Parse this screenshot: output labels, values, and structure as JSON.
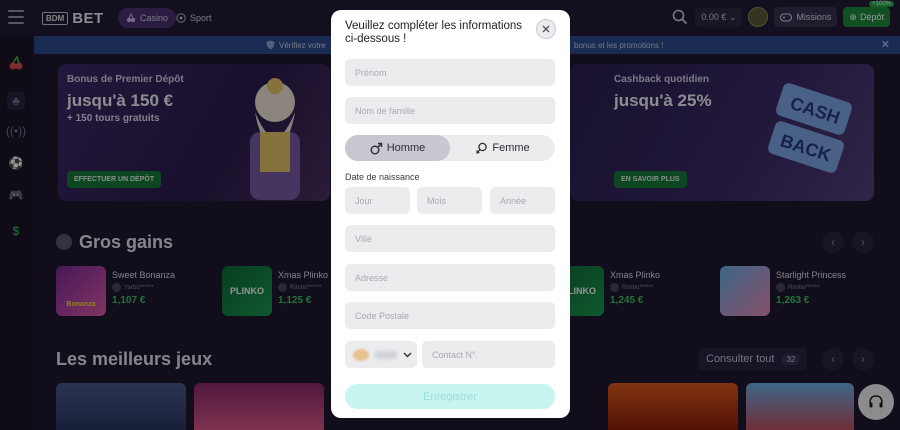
{
  "header": {
    "logo_box": "BDM",
    "logo_text": "BET",
    "nav": {
      "casino": "Casino",
      "sport": "Sport"
    },
    "balance": "0.00 € ⌄",
    "missions": "Missions",
    "depot": "Dépôt",
    "depot_badge": "+100%"
  },
  "notice": {
    "left": "Vérifiez votre",
    "right": "bonus et les promotions !"
  },
  "banners": [
    {
      "title": "Bonus de Premier Dépôt",
      "big": "jusqu'à 150 €",
      "sub": "+ 150 tours gratuits",
      "button": "EFFECTUER UN DÉPÔT"
    },
    {
      "title": "Cashback quotidien",
      "big": "jusqu'à 25%",
      "button": "EN SAVOIR PLUS",
      "art_text_1": "CASH",
      "art_text_2": "BACK"
    }
  ],
  "gros_gains": {
    "title": "Gros gains",
    "cards": [
      {
        "game": "Sweet Bonanza",
        "user": "Yarbo******",
        "amount": "1,107 €",
        "thumb_text": "Bonanza"
      },
      {
        "game": "Xmas Plinko",
        "user": "Rimbo******",
        "amount": "1,125 €",
        "thumb_text": "PLINKO"
      },
      {
        "game": "Xmas Plinko",
        "user": "Rimbo******",
        "amount": "1,245 €",
        "thumb_text": "PLINKO"
      },
      {
        "game": "Starlight Princess",
        "user": "Rimbo******",
        "amount": "1,263 €",
        "thumb_text": ""
      }
    ]
  },
  "meilleurs_jeux": {
    "title": "Les meilleurs jeux",
    "consult": "Consulter tout",
    "count": "32"
  },
  "modal": {
    "title": "Veuillez compléter les informations ci-dessous !",
    "prenom": "Prénom",
    "nom": "Nom de famille",
    "gender_male": "Homme",
    "gender_female": "Femme",
    "dob_label": "Date de naissance",
    "jour": "Jour",
    "mois": "Mois",
    "annee": "Année",
    "ville": "Ville",
    "adresse": "Adresse",
    "code_postale": "Code Postale",
    "contact": "Contact N°.",
    "submit": "Enregistrer"
  },
  "colors": {
    "accent_green": "#1e8a3c",
    "win_green": "#3fc564",
    "submit_bg": "#c8f5f0",
    "notice_blue": "#2c4b8e"
  }
}
